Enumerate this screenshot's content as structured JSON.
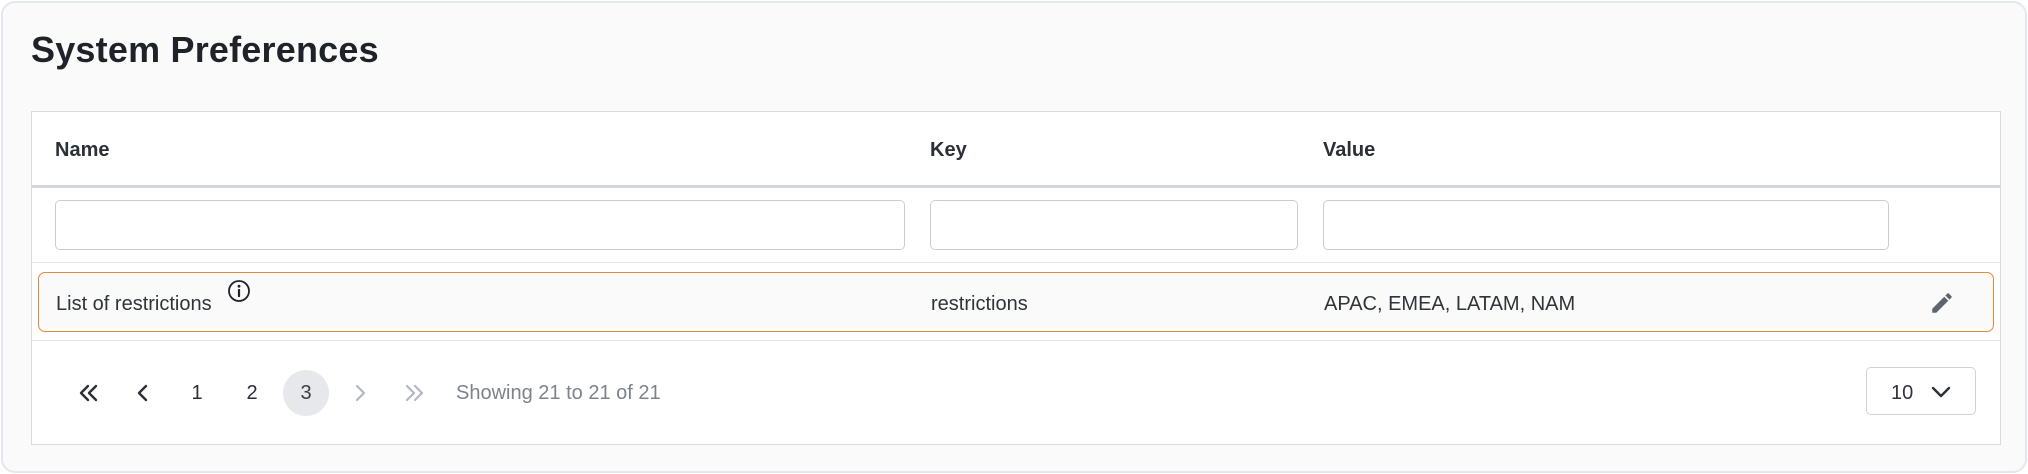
{
  "page": {
    "title": "System Preferences"
  },
  "table": {
    "columns": [
      "Name",
      "Key",
      "Value"
    ],
    "filters": {
      "name_value": "",
      "key_value": "",
      "value_value": ""
    },
    "rows": [
      {
        "name": "List of restrictions",
        "key": "restrictions",
        "value": "APAC, EMEA, LATAM, NAM",
        "info_icon": "info-icon",
        "edit_icon": "pencil-icon"
      }
    ]
  },
  "pagination": {
    "first_icon": "double-chevron-left-icon",
    "prev_icon": "chevron-left-icon",
    "pages": [
      "1",
      "2",
      "3"
    ],
    "current_page": "3",
    "next_icon": "chevron-right-icon",
    "last_icon": "double-chevron-right-icon",
    "showing_text": "Showing 21 to 21 of 21",
    "page_size": "10",
    "page_size_icon": "chevron-down-icon"
  },
  "colors": {
    "row_highlight_border": "#e08a3a",
    "active_page_bg": "#e6e8eb",
    "disabled_icon": "#b3b8bf"
  }
}
